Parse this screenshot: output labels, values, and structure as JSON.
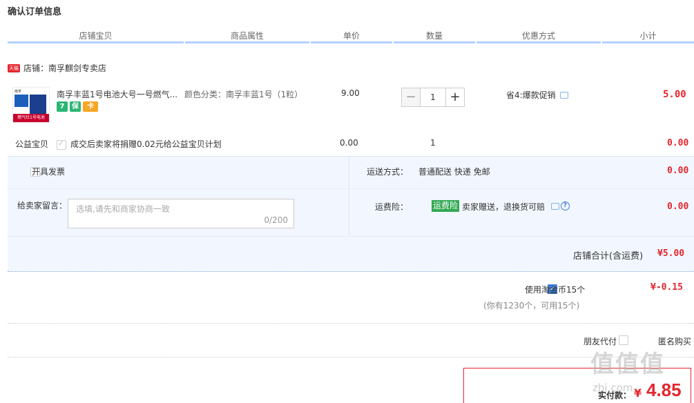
{
  "page": {
    "title": "确认订单信息"
  },
  "columns": [
    "店铺宝贝",
    "商品属性",
    "单价",
    "数量",
    "优惠方式",
    "小计"
  ],
  "shop": {
    "badge": "天猫",
    "label": "店铺：南孚麒剑专卖店"
  },
  "item": {
    "name": "南孚丰蓝1号电池大号一号燃气...",
    "tags": [
      {
        "text": "7",
        "color": "#2cb675"
      },
      {
        "text": "保",
        "color": "#2cb675"
      },
      {
        "text": "卡",
        "color": "#f6a623"
      }
    ],
    "attributes": "颜色分类：南孚丰蓝1号（1粒）",
    "price": "9.00",
    "quantity": "1",
    "promo": "省4:爆款促销",
    "subtotal": "5.00",
    "thumb": {
      "top": "南孚",
      "bottom": "燃气灶1号电池"
    }
  },
  "charity": {
    "label": "公益宝贝",
    "text": "成交后卖家将捐赠0.02元给公益宝贝计划",
    "price": "0.00",
    "quantity": "1",
    "subtotal": "0.00"
  },
  "invoice": {
    "label": "开具发票"
  },
  "shipping": {
    "label": "运送方式：",
    "value": "普通配送 快递 免邮",
    "subtotal": "0.00"
  },
  "memo": {
    "label": "给卖家留言：",
    "placeholder": "选填,请先和商家协商一致",
    "count": "0/200"
  },
  "insurance": {
    "label": "运费险：",
    "badge": "运费险",
    "text": "卖家赠送，退换货可赔",
    "subtotal": "0.00"
  },
  "shop_total": {
    "label": "店铺合计(含运费)",
    "value": "¥5.00"
  },
  "coins": {
    "label": "使用淘金币15个",
    "value": "¥-0.15",
    "hint": "(你有1230个，可用15个)"
  },
  "options": {
    "friend_pay": "朋友代付",
    "anonymous": "匿名购买"
  },
  "payment": {
    "label": "实付款：",
    "currency": "¥",
    "value": "4.85"
  },
  "watermark": {
    "logo": "值值值",
    "text": "zhi.com"
  },
  "colors": {
    "accent": "#e4262e",
    "link": "#3a7bd5",
    "header_border": "#b2d1ff"
  }
}
